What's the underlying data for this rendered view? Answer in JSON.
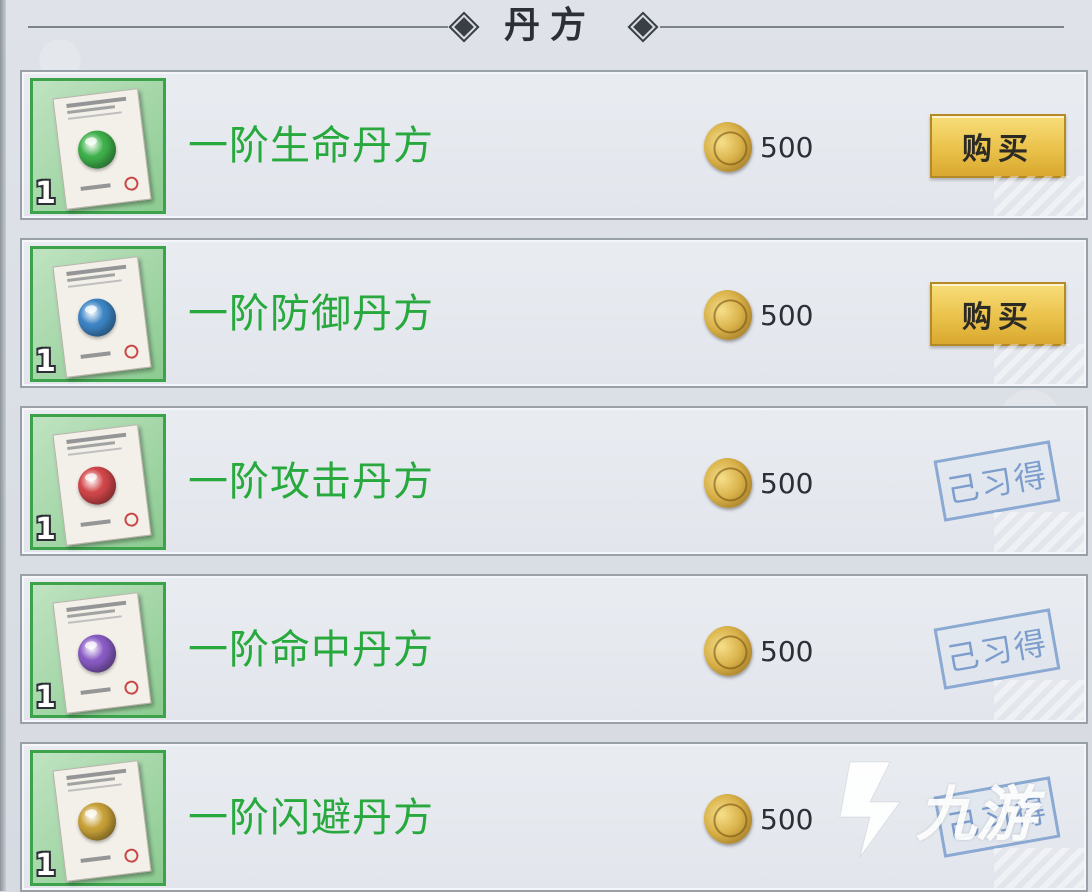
{
  "header": {
    "title": "丹方"
  },
  "items": [
    {
      "tier": "1",
      "name": "一阶生命丹方",
      "price": "500",
      "action": "购买",
      "status": "buy",
      "orb_color": "#3fb24c"
    },
    {
      "tier": "1",
      "name": "一阶防御丹方",
      "price": "500",
      "action": "购买",
      "status": "buy",
      "orb_color": "#3d86c6"
    },
    {
      "tier": "1",
      "name": "一阶攻击丹方",
      "price": "500",
      "action": "己习得",
      "status": "learned",
      "orb_color": "#d2474a"
    },
    {
      "tier": "1",
      "name": "一阶命中丹方",
      "price": "500",
      "action": "己习得",
      "status": "learned",
      "orb_color": "#8a5cc6"
    },
    {
      "tier": "1",
      "name": "一阶闪避丹方",
      "price": "500",
      "action": "己习得",
      "status": "learned",
      "orb_color": "#c9a238"
    }
  ],
  "watermark": {
    "text": "九游"
  }
}
